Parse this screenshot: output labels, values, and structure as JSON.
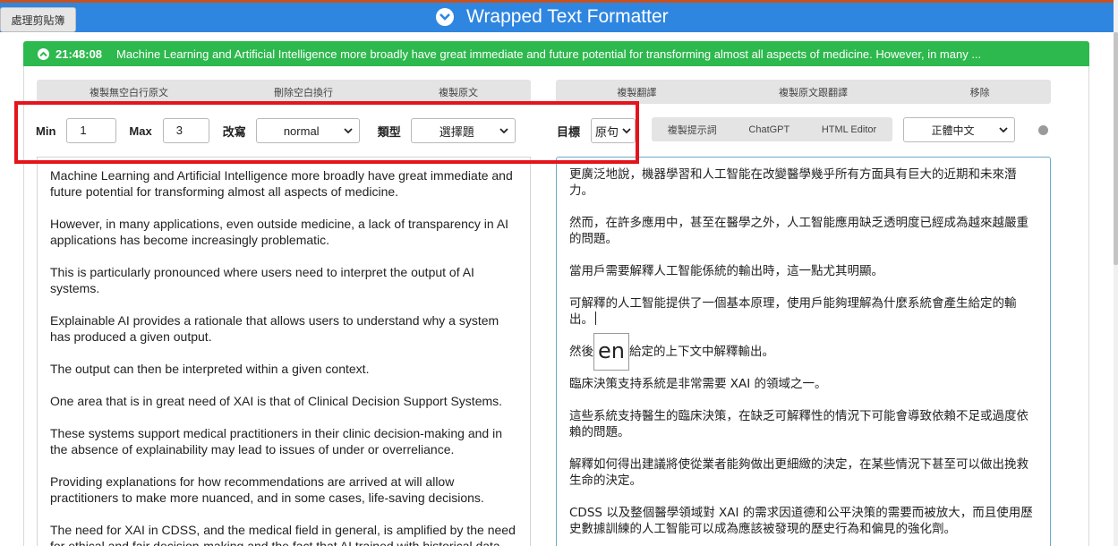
{
  "header": {
    "clipboard_button": "處理剪貼簿",
    "title": "Wrapped Text Formatter",
    "toggle_icon": "chevron-down-circle-icon"
  },
  "notice": {
    "icon": "chevron-up-circle-icon",
    "time": "21:48:08",
    "message": "Machine Learning and Artificial Intelligence more broadly have great immediate and future potential for transforming almost all aspects of medicine. However, in many ..."
  },
  "left_toolbar": {
    "copy_no_blank_lines": "複製無空白行原文",
    "remove_blank_line_breaks": "刪除空白換行",
    "copy_original": "複製原文"
  },
  "right_toolbar": {
    "copy_translation": "複製翻譯",
    "copy_original_and_translation": "複製原文跟翻譯",
    "remove": "移除"
  },
  "settings": {
    "min_label": "Min",
    "min_value": "1",
    "max_label": "Max",
    "max_value": "3",
    "rewrite_label": "改寫",
    "rewrite_value": "normal",
    "type_label": "類型",
    "type_value": "選擇題",
    "target_label": "目標",
    "target_value": "原句"
  },
  "prompt_buttons": {
    "copy_prompt": "複製提示詞",
    "chatgpt": "ChatGPT",
    "html_editor": "HTML Editor"
  },
  "language_select": "正體中文",
  "globe_icon": "globe-icon",
  "source_paragraphs": [
    "Machine Learning and Artificial Intelligence more broadly have great immediate and future potential for transforming almost all aspects of medicine.",
    "However, in many applications, even outside medicine, a lack of transparency in AI applications has become increasingly problematic.",
    "This is particularly pronounced where users need to interpret the output of AI systems.",
    "Explainable AI provides a rationale that allows users to understand why a system has produced a given output.",
    "The output can then be interpreted within a given context.",
    "One area that is in great need of XAI is that of Clinical Decision Support Systems.",
    "These systems support medical practitioners in their clinic decision-making and in the absence of explainability may lead to issues of under or overreliance.",
    "Providing explanations for how recommendations are arrived at will allow practitioners to make more nuanced, and in some cases, life-saving decisions.",
    "The need for XAI in CDSS, and the medical field in general, is amplified by the need for ethical and fair decision-making and the fact that AI trained with historical data"
  ],
  "translation_paragraphs": [
    "更廣泛地說，機器學習和人工智能在改變醫學幾乎所有方面具有巨大的近期和未來潛力。",
    "然而，在許多應用中，甚至在醫學之外，人工智能應用缺乏透明度已經成為越來越嚴重的問題。",
    "當用戶需要解釋人工智能係統的輸出時，這一點尤其明顯。",
    "可解釋的人工智能提供了一個基本原理，使用戶能夠理解為什麼系統會產生給定的輸出。",
    "然後",
    "給定的上下文中解釋輸出。",
    "臨床決策支持系統是非常需要 XAI 的領域之一。",
    "這些系統支持醫生的臨床決策，在缺乏可解釋性的情況下可能會導致依賴不足或過度依賴的問題。",
    "解釋如何得出建議將使從業者能夠做出更細緻的決定，在某些情況下甚至可以做出挽救生命的決定。",
    "CDSS 以及整個醫學領域對 XAI 的需求因道德和公平決策的需要而被放大，而且使用歷史數據訓練的人工智能可以成為應該被發現的歷史行為和偏見的強化劑。"
  ],
  "ime_indicator": "en"
}
